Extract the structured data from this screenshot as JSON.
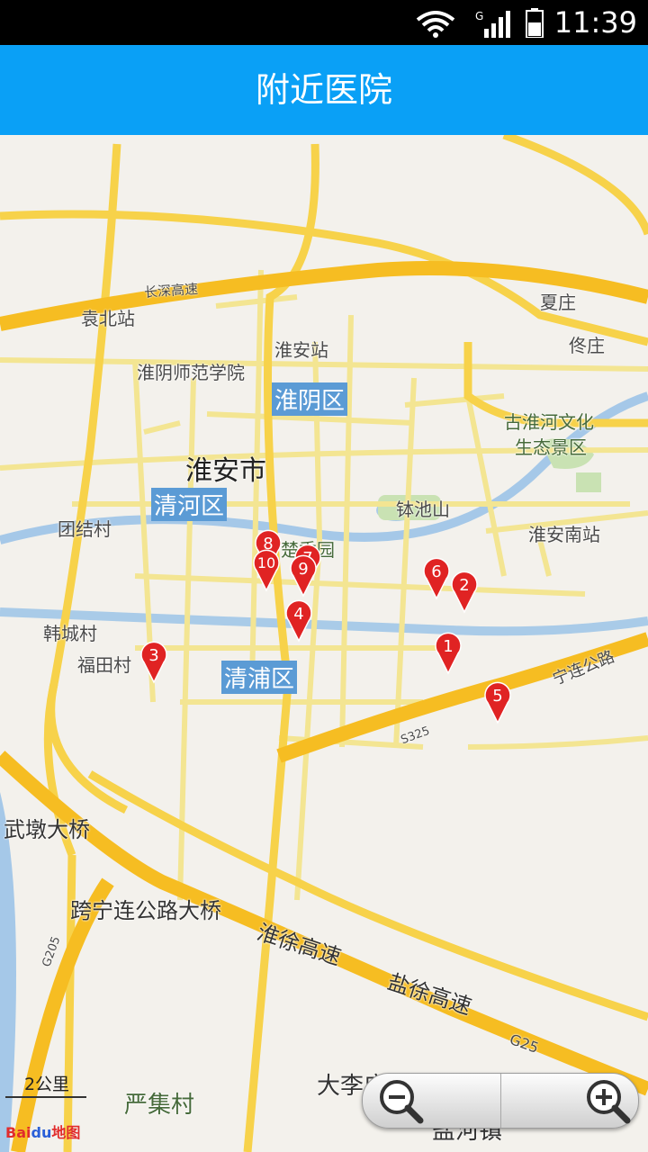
{
  "status_bar": {
    "time": "11:39",
    "signal_type": "G",
    "icons": [
      "wifi-icon",
      "cell-signal-icon",
      "battery-icon"
    ]
  },
  "header": {
    "title": "附近医院"
  },
  "map": {
    "city_label": "淮安市",
    "districts": [
      "淮阴区",
      "清河区",
      "清浦区"
    ],
    "places": [
      "袁北站",
      "淮安站",
      "淮阴师范学院",
      "夏庄",
      "佟庄",
      "古淮河文化",
      "生态景区",
      "钵池山",
      "淮安南站",
      "团结村",
      "楚秀园",
      "韩城村",
      "福田村",
      "武墩大桥",
      "跨宁连公路大桥",
      "严集村",
      "大李庄",
      "盐河镇"
    ],
    "roads": [
      "长深高速",
      "淮徐高速",
      "盐徐高速",
      "宁连公路",
      "G25",
      "S325",
      "G205"
    ],
    "markers": [
      "1",
      "2",
      "3",
      "4",
      "5",
      "6",
      "7",
      "8",
      "9",
      "10"
    ],
    "scale_label": "2公里",
    "logo": {
      "bai": "Bai",
      "du": "du",
      "suffix": "地图"
    }
  },
  "colors": {
    "header": "#0aa0f6",
    "marker": "#e02323",
    "highway": "#f7c42a",
    "road": "#f5e88a",
    "water": "#9ec6e6",
    "park": "#c9e2b3"
  }
}
